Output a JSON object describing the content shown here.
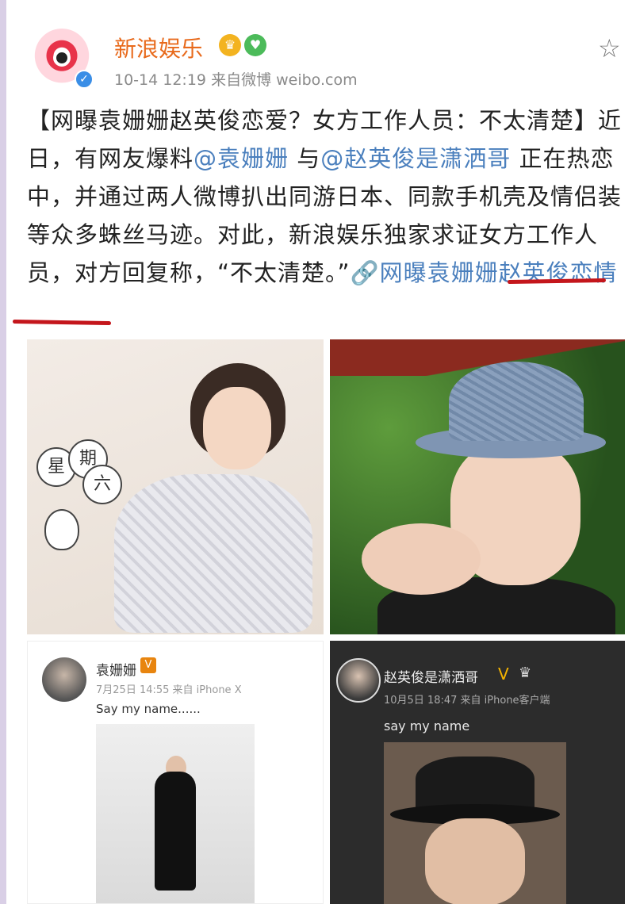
{
  "account": {
    "name": "新浪娱乐",
    "time": "10-14 12:19",
    "source": "来自微博 weibo.com",
    "verified_icon": "check-icon",
    "badge_icons": [
      "crown-badge-icon",
      "heart-badge-icon"
    ]
  },
  "post": {
    "part1": "【网曝袁姗姗赵英俊恋爱？女方工作人员：不太清楚】近日，有网友爆料",
    "mention1": "@袁姗姗",
    "part2": " 与",
    "mention2": "@赵英俊是潇洒哥",
    "part3": " 正在热恋中，并通过两人微博扒出同游日本、同款手机壳及情侣装等众多蛛丝马迹。对此，新浪娱乐独家求证女方工作人员，对方回复称，“不太清楚。”",
    "topic_link": "网曝袁姗姗赵英俊恋情"
  },
  "photo1": {
    "balloons": [
      "星",
      "期",
      "六"
    ]
  },
  "screenshot_left": {
    "name": "袁姗姗",
    "v_badge": "V",
    "meta": "7月25日 14:55 来自 iPhone X",
    "text": "Say my name......"
  },
  "screenshot_right": {
    "name": "赵英俊是潇洒哥",
    "v_badge": "V",
    "meta": "10月5日 18:47 来自 iPhone客户端",
    "text": "say my name"
  },
  "colors": {
    "name_orange": "#e86a1c",
    "link_blue": "#4a7fbd",
    "underline_red": "#c4161c"
  }
}
